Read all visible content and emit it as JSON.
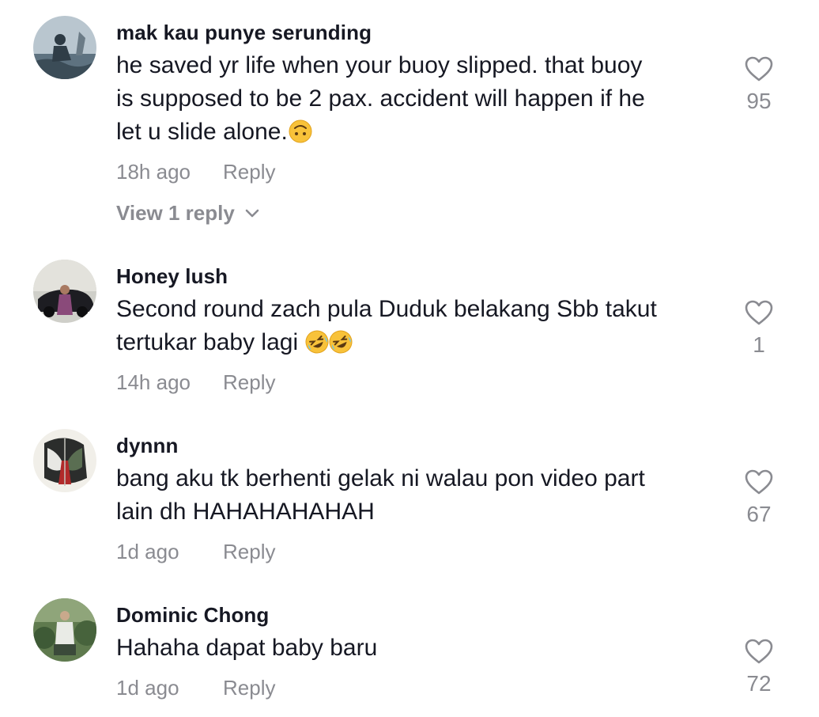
{
  "comments": [
    {
      "username": "mak kau punye serunding",
      "text": "he saved yr life when your buoy slipped. that buoy\nis supposed to be 2 pax. accident will happen if he\nlet u slide alone.",
      "emoji": "upside-down-face",
      "time": "18h ago",
      "reply_label": "Reply",
      "view_replies": "View 1 reply",
      "likes": "95"
    },
    {
      "username": "Honey lush",
      "text": "Second round zach pula Duduk belakang Sbb takut\ntertukar baby lagi ",
      "emoji": "rolling-on-floor-laughing x2",
      "time": "14h ago",
      "reply_label": "Reply",
      "likes": "1"
    },
    {
      "username": "dynnn",
      "text": "bang aku tk berhenti gelak ni walau pon video part\nlain dh HAHAHAHAHAH",
      "time": "1d ago",
      "reply_label": "Reply",
      "likes": "67"
    },
    {
      "username": "Dominic Chong",
      "text": "Hahaha dapat baby baru",
      "time": "1d ago",
      "reply_label": "Reply",
      "likes": "72"
    }
  ],
  "icons": {
    "like": "heart-outline-icon",
    "expand": "chevron-down-icon"
  },
  "colors": {
    "primary_text": "#161823",
    "secondary_text": "#8a8b91"
  }
}
